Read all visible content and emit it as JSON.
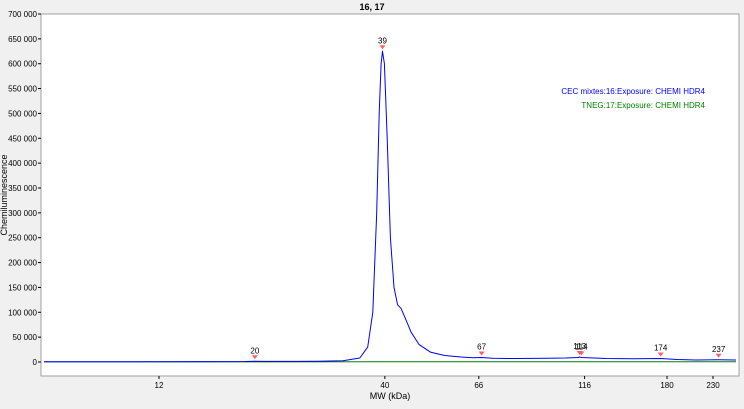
{
  "chart_data": {
    "type": "line",
    "title": "16, 17",
    "xlabel": "MW (kDa)",
    "ylabel": "Chemiluminescence",
    "x_scale": "log",
    "xlim": [
      6.5,
      260
    ],
    "ylim": [
      0,
      700000
    ],
    "x_ticks": [
      {
        "value": 12,
        "label": "12"
      },
      {
        "value": 40,
        "label": "40"
      },
      {
        "value": 66,
        "label": "66"
      },
      {
        "value": 116,
        "label": "116"
      },
      {
        "value": 180,
        "label": "180"
      },
      {
        "value": 230,
        "label": "230"
      }
    ],
    "y_ticks": [
      {
        "value": 0,
        "label": "0"
      },
      {
        "value": 50000,
        "label": "50 000"
      },
      {
        "value": 100000,
        "label": "100 000"
      },
      {
        "value": 150000,
        "label": "150 000"
      },
      {
        "value": 200000,
        "label": "200 000"
      },
      {
        "value": 250000,
        "label": "250 000"
      },
      {
        "value": 300000,
        "label": "300 000"
      },
      {
        "value": 350000,
        "label": "350 000"
      },
      {
        "value": 400000,
        "label": "400 000"
      },
      {
        "value": 450000,
        "label": "450 000"
      },
      {
        "value": 500000,
        "label": "500 000"
      },
      {
        "value": 550000,
        "label": "550 000"
      },
      {
        "value": 600000,
        "label": "600 000"
      },
      {
        "value": 650000,
        "label": "650 000"
      },
      {
        "value": 700000,
        "label": "700 000"
      }
    ],
    "series": [
      {
        "name": "CEC mixtes:16:Exposure: CHEMI HDR4",
        "color": "#0000ff",
        "points": [
          [
            6.5,
            500
          ],
          [
            10,
            600
          ],
          [
            15,
            800
          ],
          [
            19,
            1000
          ],
          [
            20,
            1600
          ],
          [
            21,
            1200
          ],
          [
            25,
            1200
          ],
          [
            28,
            1500
          ],
          [
            32,
            2500
          ],
          [
            35,
            8000
          ],
          [
            36.5,
            30000
          ],
          [
            37.5,
            100000
          ],
          [
            38.3,
            300000
          ],
          [
            38.8,
            500000
          ],
          [
            39.2,
            600000
          ],
          [
            39.5,
            625000
          ],
          [
            39.9,
            600000
          ],
          [
            40.5,
            450000
          ],
          [
            41.2,
            250000
          ],
          [
            42,
            150000
          ],
          [
            42.8,
            115000
          ],
          [
            43.6,
            108000
          ],
          [
            44.5,
            90000
          ],
          [
            46,
            60000
          ],
          [
            48,
            35000
          ],
          [
            51,
            20000
          ],
          [
            55,
            13000
          ],
          [
            60,
            10000
          ],
          [
            64,
            8500
          ],
          [
            67,
            9000
          ],
          [
            71,
            7500
          ],
          [
            80,
            7000
          ],
          [
            95,
            7500
          ],
          [
            105,
            8000
          ],
          [
            112,
            9000
          ],
          [
            113,
            10000
          ],
          [
            114,
            9000
          ],
          [
            118,
            8500
          ],
          [
            130,
            7000
          ],
          [
            150,
            6500
          ],
          [
            174,
            7000
          ],
          [
            190,
            5000
          ],
          [
            210,
            4000
          ],
          [
            237,
            4500
          ],
          [
            260,
            4000
          ]
        ]
      },
      {
        "name": "TNEG:17:Exposure: CHEMI HDR4",
        "color": "#008000",
        "points": [
          [
            6.5,
            200
          ],
          [
            20,
            250
          ],
          [
            40,
            350
          ],
          [
            67,
            400
          ],
          [
            113,
            500
          ],
          [
            174,
            450
          ],
          [
            260,
            400
          ]
        ]
      }
    ],
    "peaks": [
      {
        "x": 20,
        "label": "20",
        "y": 1500
      },
      {
        "x": 39.5,
        "label": "39",
        "y": 625000
      },
      {
        "x": 67,
        "label": "67",
        "y": 9000
      },
      {
        "x": 113,
        "label": "113",
        "y": 10000
      },
      {
        "x": 114,
        "label": "114",
        "y": 9000
      },
      {
        "x": 174,
        "label": "174",
        "y": 7000
      },
      {
        "x": 237,
        "label": "237",
        "y": 4500
      }
    ],
    "legend_position": "right",
    "grid": false
  }
}
